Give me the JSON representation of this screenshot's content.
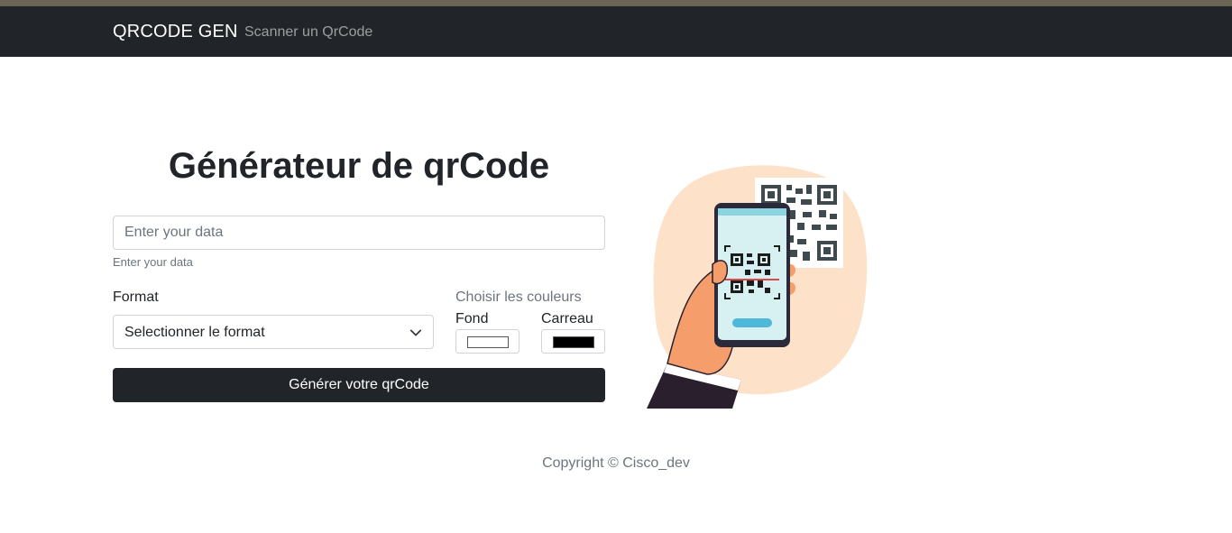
{
  "navbar": {
    "brand": "QRCODE GEN",
    "link_scan": "Scanner un QrCode"
  },
  "main": {
    "title": "Générateur de qrCode",
    "data_input": {
      "placeholder": "Enter your data",
      "value": "",
      "help_text": "Enter your data"
    },
    "format": {
      "label": "Format",
      "selected": "Selectionner le format"
    },
    "colors": {
      "label": "Choisir les couleurs",
      "background_label": "Fond",
      "background_color": "#ffffff",
      "foreground_label": "Carreau",
      "foreground_color": "#000000"
    },
    "generate_button": "Générer votre qrCode"
  },
  "footer": {
    "copyright": "Copyright © Cisco_dev"
  },
  "theme": {
    "navbar_bg": "#212529",
    "button_bg": "#212529",
    "illustration_blob": "#fde1c8",
    "phone_screen": "#d7f0f2",
    "skin": "#f59e6b"
  }
}
